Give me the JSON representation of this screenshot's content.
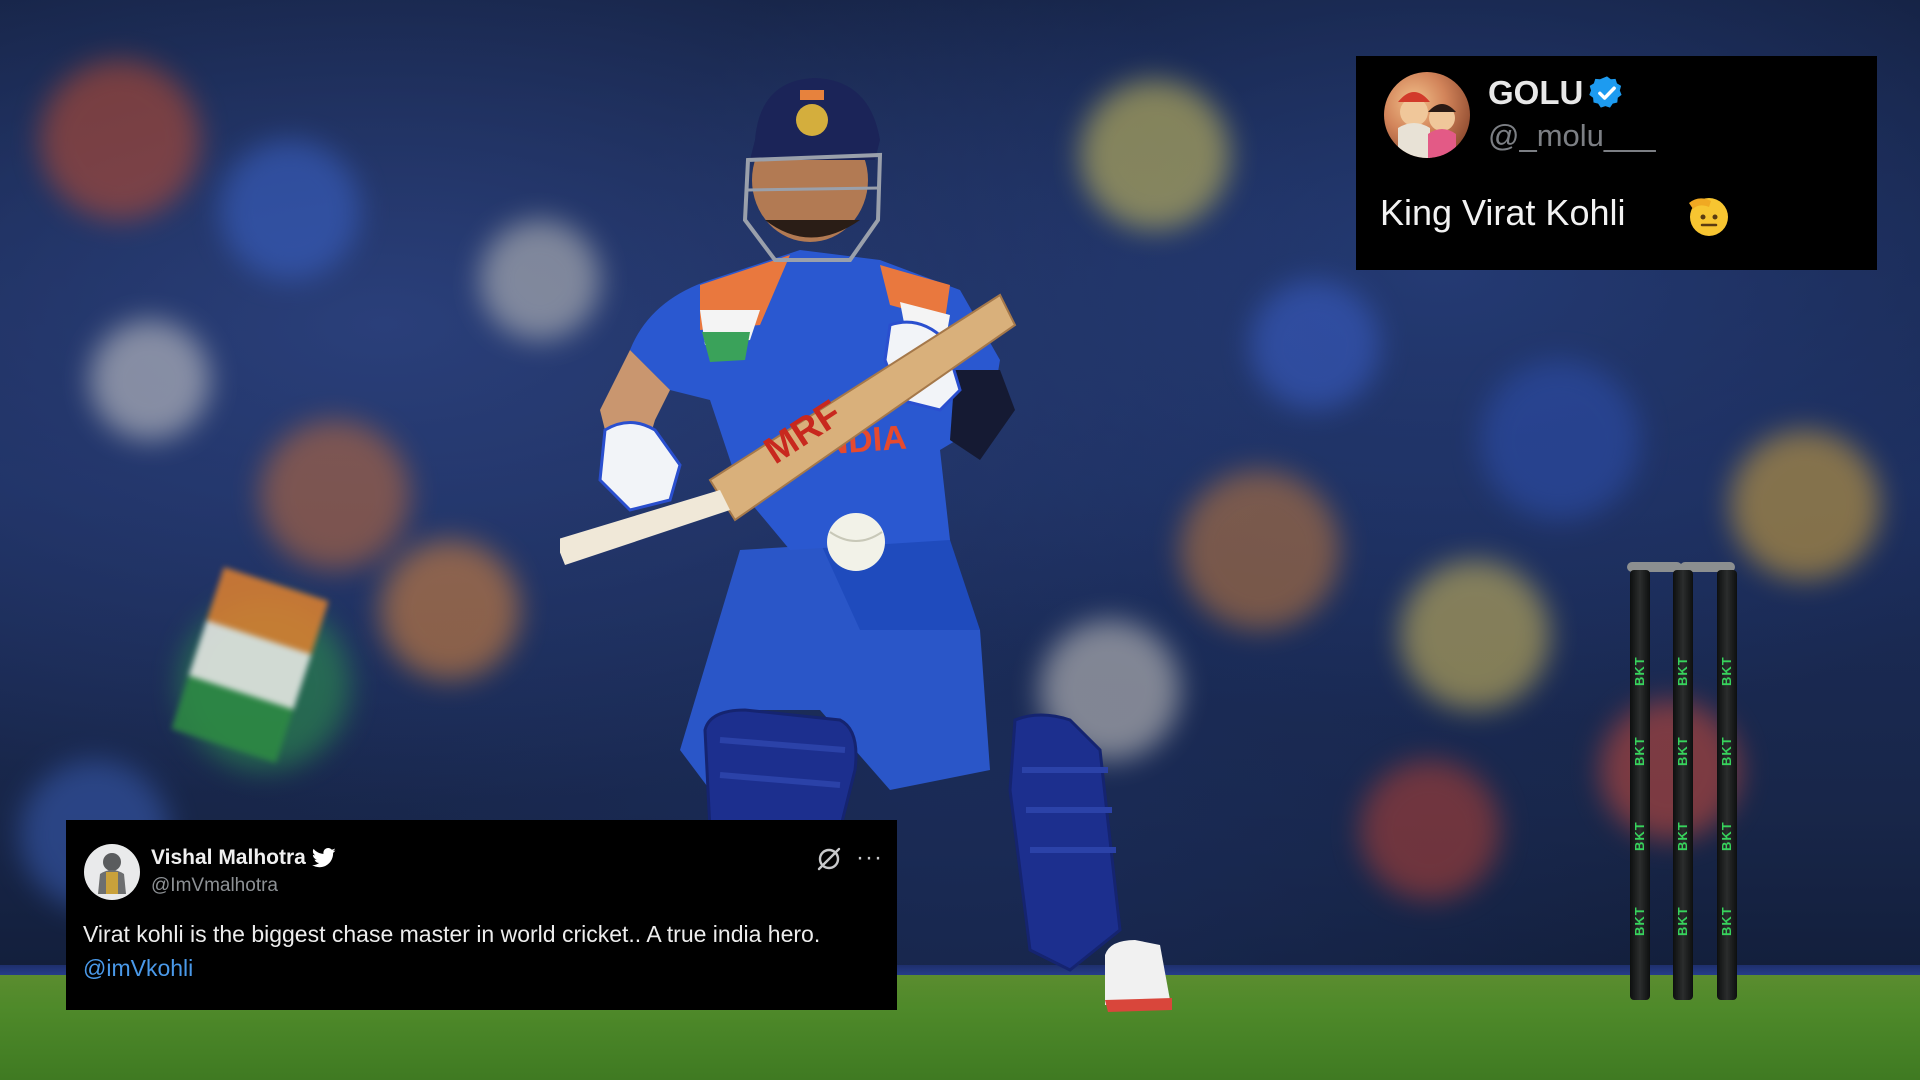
{
  "scene": {
    "stump_sponsor": "BKT"
  },
  "tweet_top_right": {
    "display_name": "GOLU",
    "handle": "@_molu___",
    "text": "King Virat Kohli",
    "verified_icon": "verified-badge-icon",
    "emoji": "saluting-face-emoji",
    "accent_color": "#1d9bf0"
  },
  "tweet_bottom_left": {
    "display_name": "Vishal Malhotra",
    "handle": "@ImVmalhotra",
    "text": "Virat kohli is the biggest chase master in world cricket.. A true india hero.",
    "mention": "@imVkohli",
    "bird_icon": "twitter-bird-icon",
    "grok_icon": "grok-icon",
    "more_icon": "more-options-icon",
    "mention_color": "#4a99e9"
  }
}
